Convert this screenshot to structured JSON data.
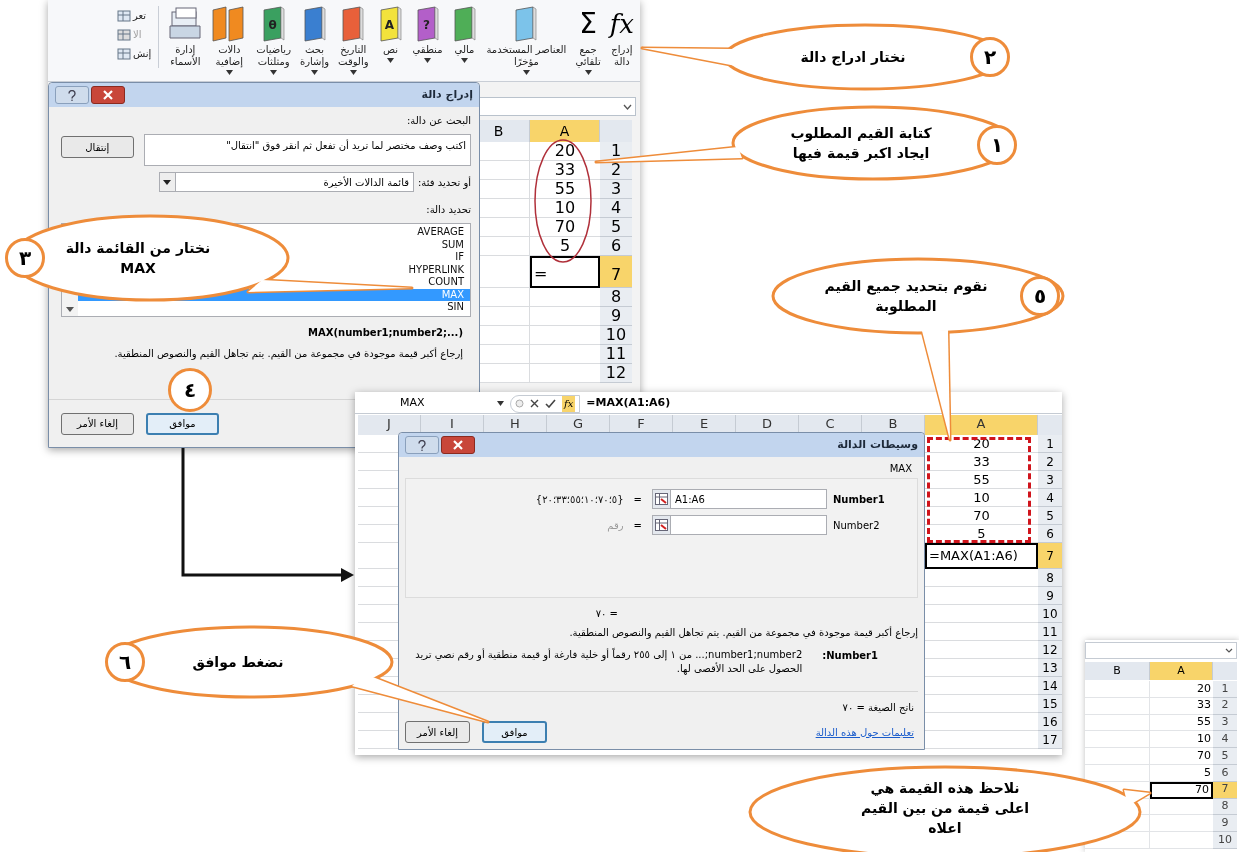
{
  "ribbon": {
    "buttons": [
      {
        "label": "إدراج\nدالة",
        "kind": "fx",
        "glyph": "fx",
        "dropdown": false
      },
      {
        "label": "جمع\nتلقائي",
        "kind": "sigma",
        "glyph": "Σ",
        "dropdown": true
      },
      {
        "label": "العناصر المستخدمة\nمؤخرًا",
        "kind": "book",
        "color": "#7cc3ea",
        "dropdown": true
      },
      {
        "label": "مالي",
        "kind": "book",
        "color": "#4fae57",
        "dropdown": true
      },
      {
        "label": "منطقي",
        "kind": "book",
        "color": "#b35fc9",
        "glyph": "?",
        "dropdown": true
      },
      {
        "label": "نص",
        "kind": "book",
        "color": "#f2e23c",
        "glyph": "A",
        "dropdown": true
      },
      {
        "label": "التاريخ\nوالوقت",
        "kind": "book",
        "color": "#e8603a",
        "dropdown": true
      },
      {
        "label": "بحث\nوإشارة",
        "kind": "book",
        "color": "#3a7fd0",
        "dropdown": true
      },
      {
        "label": "رياضيات\nومثلثات",
        "kind": "book",
        "color": "#3aa060",
        "glyph": "θ",
        "dropdown": true
      },
      {
        "label": "دالات\nإضافية",
        "kind": "books",
        "color": "#f08a20",
        "dropdown": true
      },
      {
        "label": "إدارة\nالأسماء",
        "kind": "cards",
        "dropdown": false
      }
    ],
    "side_items": [
      {
        "label": "تعر",
        "disabled": false
      },
      {
        "label": "الا",
        "disabled": true
      },
      {
        "label": "إنش",
        "disabled": false
      }
    ]
  },
  "insert_dialog": {
    "title": "إدراج دالة",
    "search_label": "البحث عن دالة:",
    "search_value": "اكتب وصف مختصر لما تريد أن تفعل ثم انقر فوق \"انتقال\"",
    "go_button": "إنتقال",
    "category_label": "أو تحديد فئة:",
    "category_value": "قائمة الدالات الأخيرة",
    "list_label": "تحديد دالة:",
    "functions": [
      {
        "name": "AVERAGE",
        "selected": false
      },
      {
        "name": "SUM",
        "selected": false
      },
      {
        "name": "IF",
        "selected": false
      },
      {
        "name": "HYPERLINK",
        "selected": false
      },
      {
        "name": "COUNT",
        "selected": false
      },
      {
        "name": "MAX",
        "selected": true
      },
      {
        "name": "SIN",
        "selected": false
      }
    ],
    "signature": "MAX(number1;number2;...)",
    "description": "إرجاع أكبر قيمة موجودة في مجموعة من القيم. يتم تجاهل القيم والنصوص المنطقية.",
    "ok_button": "موافق",
    "cancel_button": "إلغاء الأمر"
  },
  "sheet1": {
    "columns": [
      {
        "label": "A",
        "selected": true
      },
      {
        "label": "B",
        "selected": false
      }
    ],
    "rows": [
      {
        "number": "1",
        "value": "20",
        "selected": false
      },
      {
        "number": "2",
        "value": "33",
        "selected": false
      },
      {
        "number": "3",
        "value": "55",
        "selected": false
      },
      {
        "number": "4",
        "value": "10",
        "selected": false
      },
      {
        "number": "5",
        "value": "70",
        "selected": false
      },
      {
        "number": "6",
        "value": "5",
        "selected": false
      },
      {
        "number": "7",
        "value": "=",
        "selected": true
      },
      {
        "number": "8",
        "selected": false
      },
      {
        "number": "9",
        "selected": false
      },
      {
        "number": "10",
        "selected": false
      },
      {
        "number": "11",
        "selected": false
      },
      {
        "number": "12",
        "selected": false
      }
    ]
  },
  "sheet2": {
    "name_box": "MAX",
    "fx_button": "fx",
    "formula": "=MAX(A1:A6)",
    "columns": [
      {
        "label": "A",
        "selected": true
      },
      {
        "label": "B",
        "selected": false
      },
      {
        "label": "C",
        "selected": false
      },
      {
        "label": "D",
        "selected": false
      },
      {
        "label": "E",
        "selected": false
      },
      {
        "label": "F",
        "selected": false
      },
      {
        "label": "G",
        "selected": false
      },
      {
        "label": "H",
        "selected": false
      },
      {
        "label": "I",
        "selected": false
      },
      {
        "label": "J",
        "selected": false
      }
    ],
    "rows": [
      {
        "number": "1",
        "value": "20",
        "selected": false
      },
      {
        "number": "2",
        "value": "33",
        "selected": false
      },
      {
        "number": "3",
        "value": "55",
        "selected": false
      },
      {
        "number": "4",
        "value": "10",
        "selected": false
      },
      {
        "number": "5",
        "value": "70",
        "selected": false
      },
      {
        "number": "6",
        "value": "5",
        "selected": false
      },
      {
        "number": "7",
        "value": "=MAX(A1:A6)",
        "selected": true
      },
      {
        "number": "8",
        "selected": false
      },
      {
        "number": "9",
        "selected": false
      },
      {
        "number": "10",
        "selected": false
      },
      {
        "number": "11",
        "selected": false
      },
      {
        "number": "12",
        "selected": false
      },
      {
        "number": "13",
        "selected": false
      },
      {
        "number": "14",
        "selected": false
      },
      {
        "number": "15",
        "selected": false
      },
      {
        "number": "16",
        "selected": false
      },
      {
        "number": "17",
        "selected": false
      }
    ]
  },
  "args_dialog": {
    "title": "وسيطات الدالة",
    "function": "MAX",
    "arguments": [
      {
        "label": "Number1",
        "required": true,
        "value": "A1:A6",
        "operator": "=",
        "result": "{٥؛٧٠؛١٠؛٥٥؛٣٣؛٢٠}"
      },
      {
        "label": "Number2",
        "required": false,
        "operator": "=",
        "result": "رقم"
      }
    ],
    "value_line": "= ٧٠",
    "description": "إرجاع أكبر قيمة موجودة في مجموعة من القيم. يتم تجاهل القيم والنصوص المنطقية.",
    "help_label": "Number1:",
    "help_text": "number1;number2;... من ١ إلى ٢٥٥ رقماً أو خلية فارغة أو قيمة منطقية أو رقم نصي تريد الحصول على الحد الأقصى لها.",
    "result_line": "ناتج الصيغة = ٧٠",
    "help_link": "تعليمات حول هذه الدالة",
    "ok_button": "موافق",
    "cancel_button": "إلغاء الأمر"
  },
  "sheet3": {
    "columns": [
      {
        "label": "A",
        "selected": true
      },
      {
        "label": "B",
        "selected": false
      }
    ],
    "rows": [
      {
        "number": "1",
        "value": "20",
        "selected": false
      },
      {
        "number": "2",
        "value": "33",
        "selected": false
      },
      {
        "number": "3",
        "value": "55",
        "selected": false
      },
      {
        "number": "4",
        "value": "10",
        "selected": false
      },
      {
        "number": "5",
        "value": "70",
        "selected": false
      },
      {
        "number": "6",
        "value": "5",
        "selected": false
      },
      {
        "number": "7",
        "value": "70",
        "selected": true
      },
      {
        "number": "8",
        "selected": false
      },
      {
        "number": "9",
        "selected": false
      },
      {
        "number": "10",
        "selected": false
      }
    ]
  },
  "callouts": [
    {
      "number": "٢",
      "text": "نختار ادراج دالة"
    },
    {
      "number": "١",
      "text": "كتابة القيم المطلوب\nايجاد اكبر قيمة فيها"
    },
    {
      "number": "٣",
      "text": "نختار من القائمة دالة\nMAX"
    },
    {
      "number": "٤"
    },
    {
      "number": "٥",
      "text": "نقوم بتحديد جميع القيم\nالمطلوبة"
    },
    {
      "number": "٦",
      "text": "نضغط موافق"
    },
    {
      "text": "نلاحظ هذه القيمة هي\nاعلى قيمة من بين القيم\nاعلاه"
    }
  ]
}
